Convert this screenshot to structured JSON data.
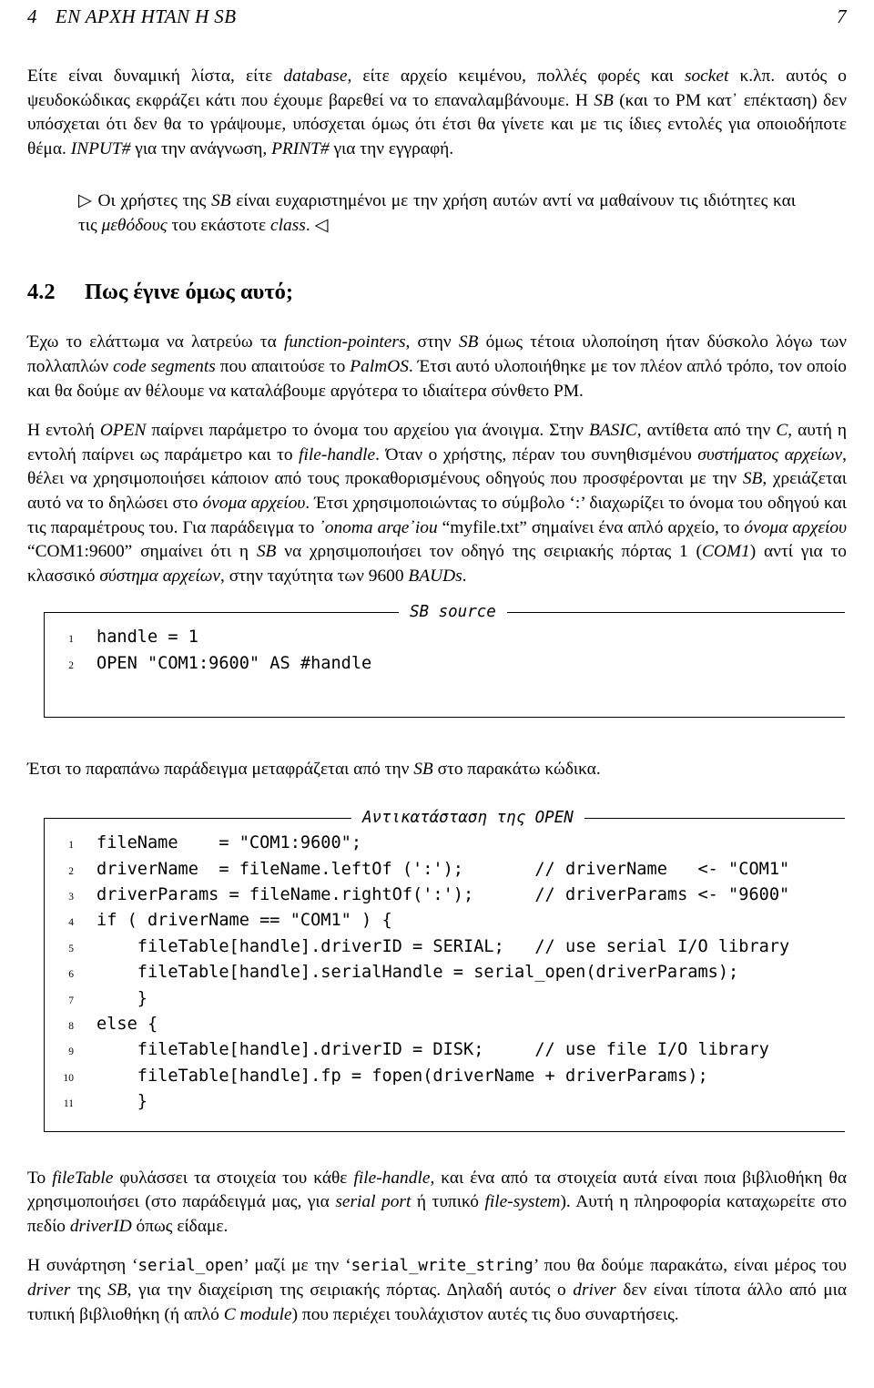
{
  "running_head": {
    "chapter_number": "4",
    "chapter_title": "ΕΝ ΑΡΧΗ ΗΤΑΝ Η SB",
    "page_number": "7"
  },
  "paragraphs": {
    "intro": {
      "t1": "Είτε είναι δυναμική λίστα, είτε ",
      "i1": "database",
      "t2": ", είτε αρχείο κειμένου, πολλές φορές και ",
      "i2": "socket",
      "t3": " κ.λπ. αυτός ο ψευδοκώδικας εκφράζει κάτι που έχουμε βαρεθεί να το επαναλαμβάνουμε. Η ",
      "i3": "SB",
      "t4": " (και το PM κατ᾿ επέκταση) δεν υπόσχεται ότι δεν θα το γράψουμε, υπόσχεται όμως ότι έτσι θα γίνετε και με τις ίδιες εντολές για οποιοδήποτε θέμα. ",
      "i4": "INPUT#",
      "t5": " για την ανάγνωση, ",
      "i5": "PRINT#",
      "t6": " για την εγγραφή."
    },
    "remark": {
      "open_marker": "▷",
      "close_marker": "◁",
      "t1": " Οι χρήστες της ",
      "i1": "SB",
      "t2": " είναι ευχαριστημένοι με την χρήση αυτών αντί να μαθαίνουν τις ιδιότητες και τις ",
      "i2": "μεθόδους",
      "t3": " του εκάστοτε ",
      "i3": "class",
      "t4": ". "
    },
    "p1": {
      "t1": "Έχω το ελάττωμα να λατρεύω τα ",
      "i1": "function-pointers",
      "t2": ", στην ",
      "i2": "SB",
      "t3": " όμως τέτοια υλοποίηση ήταν δύσκολο λόγω των πολλαπλών ",
      "i3": "code segments",
      "t4": " που απαιτούσε το ",
      "i4": "PalmOS",
      "t5": ". Έτσι αυτό υλοποιήθηκε με τον πλέον απλό τρόπο, τον οποίο και θα δούμε αν θέλουμε να καταλάβουμε αργότερα το ιδιαίτερα σύνθετο PM."
    },
    "p2": {
      "t1": "Η εντολή ",
      "i1": "OPEN",
      "t2": " παίρνει παράμετρο το όνομα του αρχείου για άνοιγμα. Στην ",
      "i2": "BASIC",
      "t3": ", αντίθετα από την ",
      "i3": "C",
      "t4": ", αυτή η εντολή παίρνει ως παράμετρο και το ",
      "i4": "file-handle",
      "t5": ". Όταν ο χρήστης, πέραν του συνηθισμένου ",
      "i5": "συστήματος αρχείων",
      "t6": ", θέλει να χρησιμοποιήσει κάποιον από τους προκαθορισμένους οδηγούς που προσφέρονται με την ",
      "i6": "SB",
      "t7": ", χρειάζεται αυτό να το δηλώσει στο ",
      "i7": "όνομα αρχείου",
      "t8": ". Έτσι χρησιμοποιώντας το σύμβολο ‘:’ διαχωρίζει το όνομα του οδηγού και τις παραμέτρους του. Για παράδειγμα το ",
      "i8": "᾿onoma arqe᾿iou",
      "t9": " “myfile.txt” σημαίνει ένα απλό αρχείο, το ",
      "i9": "όνομα αρχείου",
      "t10": " “COM1:9600” σημαίνει ότι η ",
      "i10": "SB",
      "t11": " να χρησιμοποιήσει τον οδηγό της σειριακής πόρτας 1 (",
      "i11": "COM1",
      "t12": ") αντί για το κλασσικό ",
      "i12": "σύστημα αρχείων",
      "t13": ", στην ταχύτητα των 9600 ",
      "i13": "BAUDs",
      "t14": "."
    },
    "p3": {
      "t1": "Έτσι το παραπάνω παράδειγμα μεταφράζεται από την ",
      "i1": "SB",
      "t2": " στο παρακάτω κώδικα."
    },
    "p4": {
      "t1": "Το ",
      "i1": "fileTable",
      "t2": " φυλάσσει τα στοιχεία του κάθε ",
      "i2": "file-handle",
      "t3": ", και ένα από τα στοιχεία αυτά είναι ποια βιβλιοθήκη θα χρησιμοποιήσει (στο παράδειγμά μας, για ",
      "i3": "serial port",
      "t4": " ή τυπικό ",
      "i4": "file-system",
      "t5": "). Αυτή η πληροφορία καταχωρείτε στο πεδίο ",
      "i5": "driverID",
      "t6": " όπως είδαμε."
    },
    "p5": {
      "t1": "Η συνάρτηση ‘",
      "m1": "serial_open",
      "t2": "’ μαζί με την ‘",
      "m2": "serial_write_string",
      "t3": "’ που θα δούμε παρακάτω, είναι μέρος του ",
      "i3": "driver",
      "t4": " της ",
      "i4": "SB",
      "t5": ", για την διαχείριση της σειριακής πόρτας. Δηλαδή αυτός ο ",
      "i5": "driver",
      "t6": " δεν είναι τίποτα άλλο από μια τυπική βιβλιοθήκη (ή απλό ",
      "i6": "C module",
      "t7": ") που περιέχει τουλάχιστον αυτές τις δυο συναρτήσεις."
    }
  },
  "section": {
    "number": "4.2",
    "title": "Πως έγινε όμως αυτό;"
  },
  "listing_sb": {
    "title": "SB source",
    "lines": [
      {
        "no": "1",
        "code": "handle = 1"
      },
      {
        "no": "2",
        "code": "OPEN \"COM1:9600\" AS #handle"
      }
    ]
  },
  "listing_open": {
    "title": "Αντικατάσταση της OPEN",
    "lines": [
      {
        "no": "1",
        "code": "fileName    = \"COM1:9600\";"
      },
      {
        "no": "2",
        "code": "driverName  = fileName.leftOf (':');       // driverName   <- \"COM1\""
      },
      {
        "no": "3",
        "code": "driverParams = fileName.rightOf(':');      // driverParams <- \"9600\""
      },
      {
        "no": "4",
        "code": "if ( driverName == \"COM1\" ) {"
      },
      {
        "no": "5",
        "code": "    fileTable[handle].driverID = SERIAL;   // use serial I/O library"
      },
      {
        "no": "6",
        "code": "    fileTable[handle].serialHandle = serial_open(driverParams);"
      },
      {
        "no": "7",
        "code": "    }"
      },
      {
        "no": "8",
        "code": "else {"
      },
      {
        "no": "9",
        "code": "    fileTable[handle].driverID = DISK;     // use file I/O library"
      },
      {
        "no": "10",
        "code": "    fileTable[handle].fp = fopen(driverName + driverParams);"
      },
      {
        "no": "11",
        "code": "    }"
      }
    ]
  }
}
